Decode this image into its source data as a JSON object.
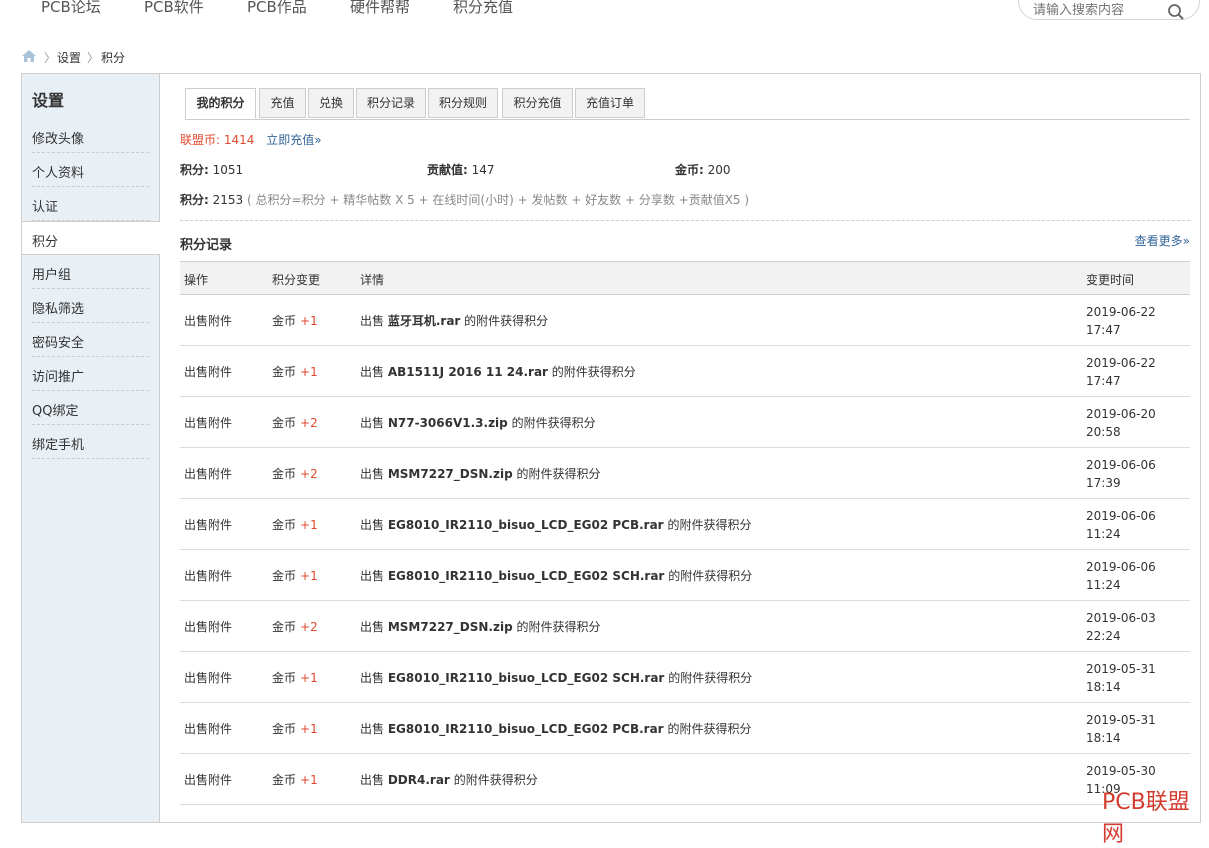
{
  "topnav": {
    "items": [
      "PCB论坛",
      "PCB软件",
      "PCB作品",
      "硬件帮帮",
      "积分充值"
    ],
    "search_placeholder": "请输入搜索内容"
  },
  "breadcrumb": {
    "home_icon": "home-icon",
    "items": [
      "设置",
      "积分"
    ]
  },
  "sidebar": {
    "title": "设置",
    "items": [
      "修改头像",
      "个人资料",
      "认证",
      "积分",
      "用户组",
      "隐私筛选",
      "密码安全",
      "访问推广",
      "QQ绑定",
      "绑定手机"
    ],
    "active_index": 3
  },
  "tabs": [
    "我的积分",
    "充值",
    "兑换",
    "积分记录",
    "积分规则",
    "积分充值",
    "充值订单"
  ],
  "summary": {
    "lianmeng_label": "联盟币:",
    "lianmeng_value": "1414",
    "recharge_link": "立即充值»",
    "jifen_label": "积分:",
    "jifen_value": "1051",
    "gongxian_label": "贡献值:",
    "gongxian_value": "147",
    "jinbi_label": "金币:",
    "jinbi_value": "200",
    "total_label": "积分:",
    "total_value": "2153",
    "formula": "( 总积分=积分 + 精华帖数 X 5 + 在线时间(小时) + 发帖数 + 好友数 + 分享数 +贡献值X5 )"
  },
  "records": {
    "title": "积分记录",
    "more": "查看更多»",
    "headers": [
      "操作",
      "积分变更",
      "详情",
      "变更时间"
    ],
    "rows": [
      {
        "op": "出售附件",
        "cur": "金币",
        "delta": "+1",
        "pre": "出售",
        "file": "蓝牙耳机.rar",
        "post": "的附件获得积分",
        "date": "2019-06-22",
        "time": "17:47"
      },
      {
        "op": "出售附件",
        "cur": "金币",
        "delta": "+1",
        "pre": "出售",
        "file": "AB1511J 2016 11 24.rar",
        "post": "的附件获得积分",
        "date": "2019-06-22",
        "time": "17:47"
      },
      {
        "op": "出售附件",
        "cur": "金币",
        "delta": "+2",
        "pre": "出售",
        "file": "N77-3066V1.3.zip",
        "post": "的附件获得积分",
        "date": "2019-06-20",
        "time": "20:58"
      },
      {
        "op": "出售附件",
        "cur": "金币",
        "delta": "+2",
        "pre": "出售",
        "file": "MSM7227_DSN.zip",
        "post": "的附件获得积分",
        "date": "2019-06-06",
        "time": "17:39"
      },
      {
        "op": "出售附件",
        "cur": "金币",
        "delta": "+1",
        "pre": "出售",
        "file": "EG8010_IR2110_bisuo_LCD_EG02 PCB.rar",
        "post": "的附件获得积分",
        "date": "2019-06-06",
        "time": "11:24"
      },
      {
        "op": "出售附件",
        "cur": "金币",
        "delta": "+1",
        "pre": "出售",
        "file": "EG8010_IR2110_bisuo_LCD_EG02 SCH.rar",
        "post": "的附件获得积分",
        "date": "2019-06-06",
        "time": "11:24"
      },
      {
        "op": "出售附件",
        "cur": "金币",
        "delta": "+2",
        "pre": "出售",
        "file": "MSM7227_DSN.zip",
        "post": "的附件获得积分",
        "date": "2019-06-03",
        "time": "22:24"
      },
      {
        "op": "出售附件",
        "cur": "金币",
        "delta": "+1",
        "pre": "出售",
        "file": "EG8010_IR2110_bisuo_LCD_EG02 SCH.rar",
        "post": "的附件获得积分",
        "date": "2019-05-31",
        "time": "18:14"
      },
      {
        "op": "出售附件",
        "cur": "金币",
        "delta": "+1",
        "pre": "出售",
        "file": "EG8010_IR2110_bisuo_LCD_EG02 PCB.rar",
        "post": "的附件获得积分",
        "date": "2019-05-31",
        "time": "18:14"
      },
      {
        "op": "出售附件",
        "cur": "金币",
        "delta": "+1",
        "pre": "出售",
        "file": "DDR4.rar",
        "post": "的附件获得积分",
        "date": "2019-05-30",
        "time": "11:09"
      }
    ]
  },
  "watermark": "PCB联盟网",
  "colors": {
    "accent_red": "#e0482e",
    "link_blue": "#336699",
    "sidebar_bg": "#e8eff5"
  }
}
